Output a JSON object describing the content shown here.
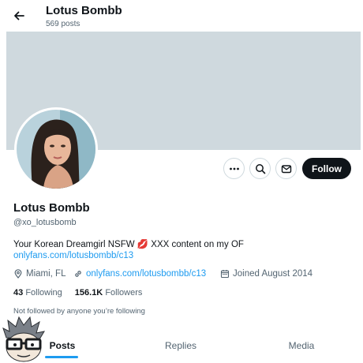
{
  "header": {
    "title": "Lotus Bombb",
    "post_count": "569 posts"
  },
  "colors": {
    "banner": "#cfd9de",
    "accent": "#1d9bf0",
    "follow_bg": "#0f1419",
    "muted": "#536471"
  },
  "profile": {
    "name": "Lotus Bombb",
    "handle": "@xo_lotusbomb",
    "bio": "Your Korean Dreamgirl NSFW 💋 XXX content on my OF",
    "bio_link": "onlyfans.com/lotusbombb/c13",
    "location": "Miami, FL",
    "website": "onlyfans.com/lotusbombb/c13",
    "joined": "Joined August 2014",
    "following_count": "43",
    "following_label": "Following",
    "followers_count": "156.1K",
    "followers_label": "Followers",
    "not_followed_text": "Not followed by anyone you’re following"
  },
  "actions": {
    "more_icon": "more-horizontal-icon",
    "search_icon": "search-icon",
    "message_icon": "envelope-icon",
    "follow_label": "Follow"
  },
  "tabs": [
    {
      "label": "Posts",
      "active": true
    },
    {
      "label": "Replies",
      "active": false
    },
    {
      "label": "Media",
      "active": false
    }
  ]
}
